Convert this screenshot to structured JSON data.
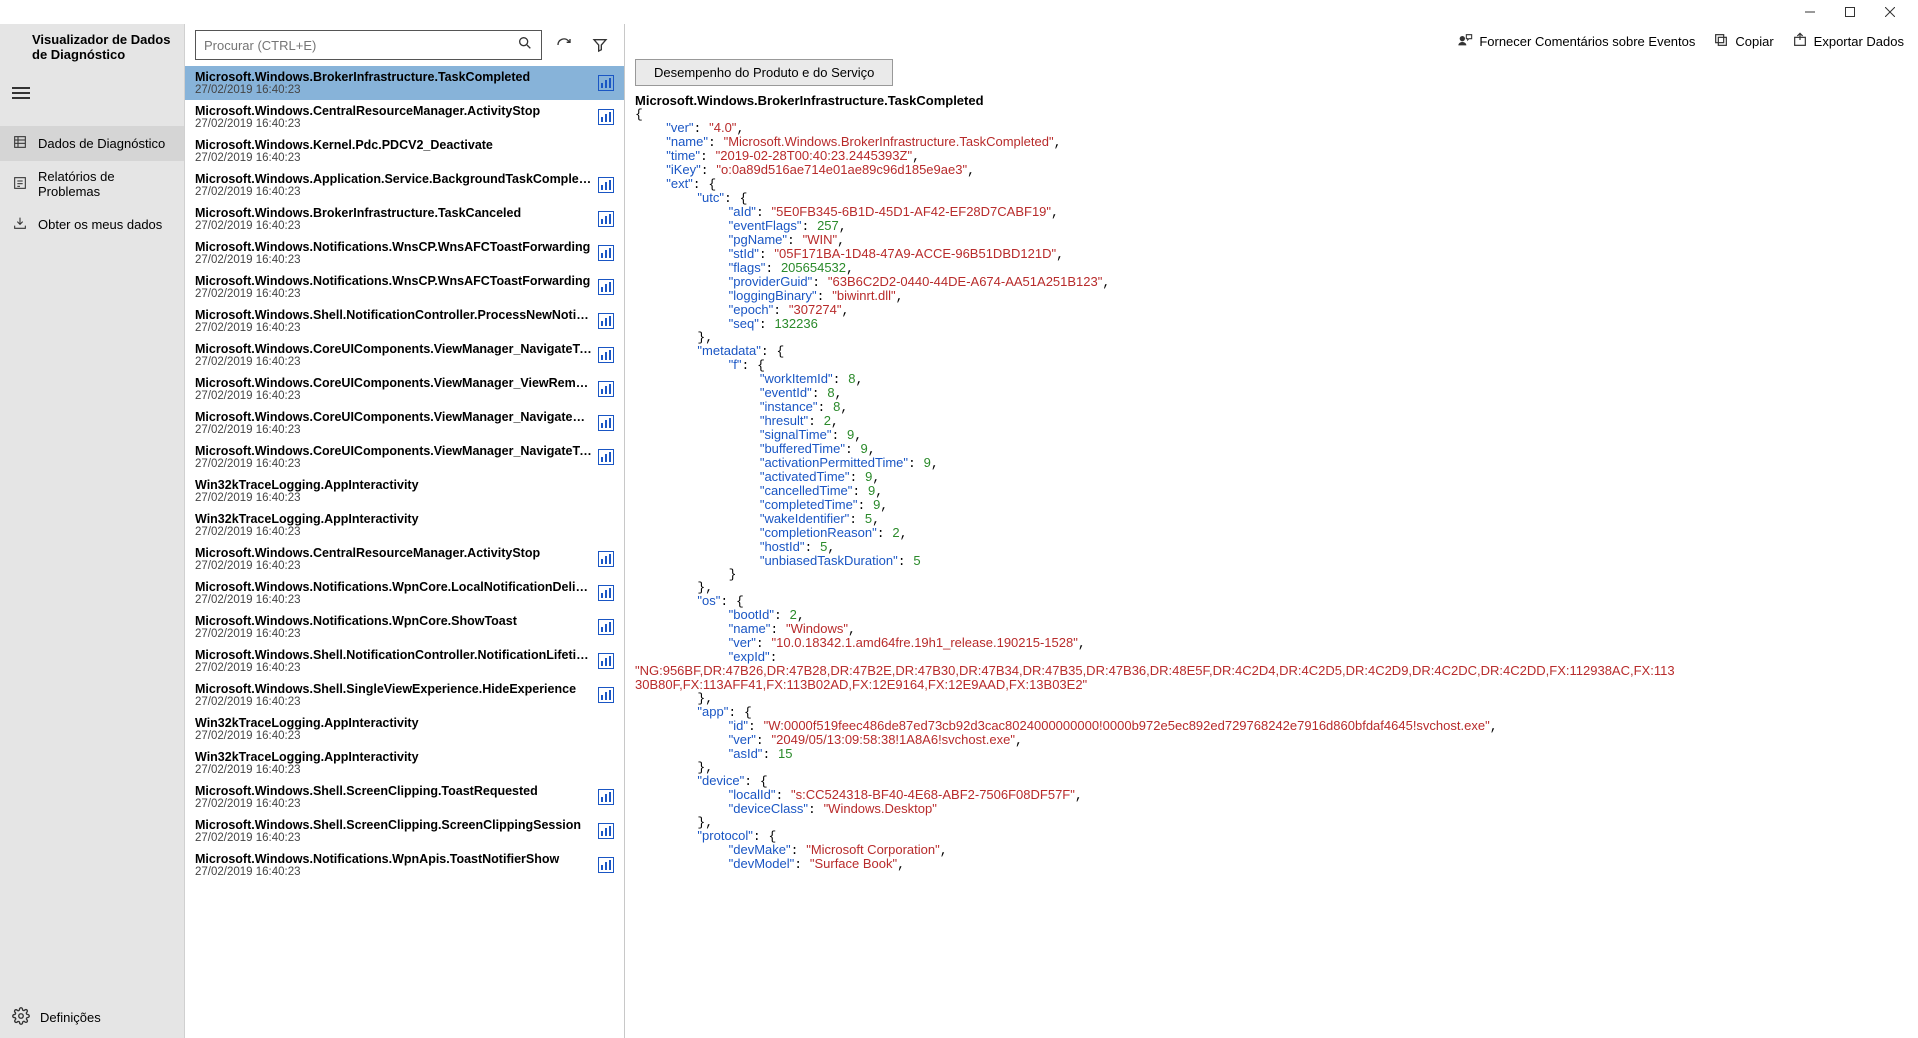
{
  "window": {
    "title": "Visualizador de Dados de Diagnóstico"
  },
  "sidebar": {
    "nav": [
      {
        "label": "Dados de Diagnóstico",
        "active": true
      },
      {
        "label": "Relatórios de Problemas",
        "active": false
      },
      {
        "label": "Obter os meus dados",
        "active": false
      }
    ],
    "settings_label": "Definições"
  },
  "search": {
    "placeholder": "Procurar (CTRL+E)",
    "value": ""
  },
  "toolbar_detail": {
    "feedback": "Fornecer Comentários sobre Eventos",
    "copy": "Copiar",
    "export": "Exportar Dados"
  },
  "category_button": "Desempenho do Produto e do Serviço",
  "events": [
    {
      "name": "Microsoft.Windows.BrokerInfrastructure.TaskCompleted",
      "date": "27/02/2019 16:40:23",
      "hasChart": true,
      "selected": true
    },
    {
      "name": "Microsoft.Windows.CentralResourceManager.ActivityStop",
      "date": "27/02/2019 16:40:23",
      "hasChart": true
    },
    {
      "name": "Microsoft.Windows.Kernel.Pdc.PDCV2_Deactivate",
      "date": "27/02/2019 16:40:23",
      "hasChart": false
    },
    {
      "name": "Microsoft.Windows.Application.Service.BackgroundTaskCompleted",
      "date": "27/02/2019 16:40:23",
      "hasChart": true
    },
    {
      "name": "Microsoft.Windows.BrokerInfrastructure.TaskCanceled",
      "date": "27/02/2019 16:40:23",
      "hasChart": true
    },
    {
      "name": "Microsoft.Windows.Notifications.WnsCP.WnsAFCToastForwarding",
      "date": "27/02/2019 16:40:23",
      "hasChart": true
    },
    {
      "name": "Microsoft.Windows.Notifications.WnsCP.WnsAFCToastForwarding",
      "date": "27/02/2019 16:40:23",
      "hasChart": true
    },
    {
      "name": "Microsoft.Windows.Shell.NotificationController.ProcessNewNotificationActivity",
      "date": "27/02/2019 16:40:23",
      "hasChart": true
    },
    {
      "name": "Microsoft.Windows.CoreUIComponents.ViewManager_NavigateToView",
      "date": "27/02/2019 16:40:23",
      "hasChart": true
    },
    {
      "name": "Microsoft.Windows.CoreUIComponents.ViewManager_ViewRemoved",
      "date": "27/02/2019 16:40:23",
      "hasChart": true
    },
    {
      "name": "Microsoft.Windows.CoreUIComponents.ViewManager_NavigateAwayFromView",
      "date": "27/02/2019 16:40:23",
      "hasChart": true
    },
    {
      "name": "Microsoft.Windows.CoreUIComponents.ViewManager_NavigateToView",
      "date": "27/02/2019 16:40:23",
      "hasChart": true
    },
    {
      "name": "Win32kTraceLogging.AppInteractivity",
      "date": "27/02/2019 16:40:23",
      "hasChart": false
    },
    {
      "name": "Win32kTraceLogging.AppInteractivity",
      "date": "27/02/2019 16:40:23",
      "hasChart": false
    },
    {
      "name": "Microsoft.Windows.CentralResourceManager.ActivityStop",
      "date": "27/02/2019 16:40:23",
      "hasChart": true
    },
    {
      "name": "Microsoft.Windows.Notifications.WpnCore.LocalNotificationDelivered",
      "date": "27/02/2019 16:40:23",
      "hasChart": true
    },
    {
      "name": "Microsoft.Windows.Notifications.WpnCore.ShowToast",
      "date": "27/02/2019 16:40:23",
      "hasChart": true
    },
    {
      "name": "Microsoft.Windows.Shell.NotificationController.NotificationLifetimeActivity",
      "date": "27/02/2019 16:40:23",
      "hasChart": true
    },
    {
      "name": "Microsoft.Windows.Shell.SingleViewExperience.HideExperience",
      "date": "27/02/2019 16:40:23",
      "hasChart": true
    },
    {
      "name": "Win32kTraceLogging.AppInteractivity",
      "date": "27/02/2019 16:40:23",
      "hasChart": false
    },
    {
      "name": "Win32kTraceLogging.AppInteractivity",
      "date": "27/02/2019 16:40:23",
      "hasChart": false
    },
    {
      "name": "Microsoft.Windows.Shell.ScreenClipping.ToastRequested",
      "date": "27/02/2019 16:40:23",
      "hasChart": true
    },
    {
      "name": "Microsoft.Windows.Shell.ScreenClipping.ScreenClippingSession",
      "date": "27/02/2019 16:40:23",
      "hasChart": true
    },
    {
      "name": "Microsoft.Windows.Notifications.WpnApis.ToastNotifierShow",
      "date": "27/02/2019 16:40:23",
      "hasChart": true
    }
  ],
  "detail_json": {
    "title": "Microsoft.Windows.BrokerInfrastructure.TaskCompleted",
    "lines": [
      {
        "indent": 0,
        "prefix": "{",
        "key": null,
        "val": null
      },
      {
        "indent": 1,
        "key": "ver",
        "val": "4.0",
        "type": "str",
        "comma": true
      },
      {
        "indent": 1,
        "key": "name",
        "val": "Microsoft.Windows.BrokerInfrastructure.TaskCompleted",
        "type": "str",
        "comma": true
      },
      {
        "indent": 1,
        "key": "time",
        "val": "2019-02-28T00:40:23.2445393Z",
        "type": "str",
        "comma": true
      },
      {
        "indent": 1,
        "key": "iKey",
        "val": "o:0a89d516ae714e01ae89c96d185e9ae3",
        "type": "str",
        "comma": true
      },
      {
        "indent": 1,
        "key": "ext",
        "suffix": ": {"
      },
      {
        "indent": 2,
        "key": "utc",
        "suffix": ": {"
      },
      {
        "indent": 3,
        "key": "aId",
        "val": "5E0FB345-6B1D-45D1-AF42-EF28D7CABF19",
        "type": "str",
        "comma": true
      },
      {
        "indent": 3,
        "key": "eventFlags",
        "val": "257",
        "type": "num",
        "comma": true
      },
      {
        "indent": 3,
        "key": "pgName",
        "val": "WIN",
        "type": "str",
        "comma": true
      },
      {
        "indent": 3,
        "key": "stId",
        "val": "05F171BA-1D48-47A9-ACCE-96B51DBD121D",
        "type": "str",
        "comma": true
      },
      {
        "indent": 3,
        "key": "flags",
        "val": "205654532",
        "type": "num",
        "comma": true
      },
      {
        "indent": 3,
        "key": "providerGuid",
        "val": "63B6C2D2-0440-44DE-A674-AA51A251B123",
        "type": "str",
        "comma": true
      },
      {
        "indent": 3,
        "key": "loggingBinary",
        "val": "biwinrt.dll",
        "type": "str",
        "comma": true
      },
      {
        "indent": 3,
        "key": "epoch",
        "val": "307274",
        "type": "str",
        "comma": true
      },
      {
        "indent": 3,
        "key": "seq",
        "val": "132236",
        "type": "num"
      },
      {
        "indent": 2,
        "prefix": "},"
      },
      {
        "indent": 2,
        "key": "metadata",
        "suffix": ": {"
      },
      {
        "indent": 3,
        "key": "f",
        "suffix": ": {"
      },
      {
        "indent": 4,
        "key": "workItemId",
        "val": "8",
        "type": "num",
        "comma": true
      },
      {
        "indent": 4,
        "key": "eventId",
        "val": "8",
        "type": "num",
        "comma": true
      },
      {
        "indent": 4,
        "key": "instance",
        "val": "8",
        "type": "num",
        "comma": true
      },
      {
        "indent": 4,
        "key": "hresult",
        "val": "2",
        "type": "num",
        "comma": true
      },
      {
        "indent": 4,
        "key": "signalTime",
        "val": "9",
        "type": "num",
        "comma": true
      },
      {
        "indent": 4,
        "key": "bufferedTime",
        "val": "9",
        "type": "num",
        "comma": true
      },
      {
        "indent": 4,
        "key": "activationPermittedTime",
        "val": "9",
        "type": "num",
        "comma": true
      },
      {
        "indent": 4,
        "key": "activatedTime",
        "val": "9",
        "type": "num",
        "comma": true
      },
      {
        "indent": 4,
        "key": "cancelledTime",
        "val": "9",
        "type": "num",
        "comma": true
      },
      {
        "indent": 4,
        "key": "completedTime",
        "val": "9",
        "type": "num",
        "comma": true
      },
      {
        "indent": 4,
        "key": "wakeIdentifier",
        "val": "5",
        "type": "num",
        "comma": true
      },
      {
        "indent": 4,
        "key": "completionReason",
        "val": "2",
        "type": "num",
        "comma": true
      },
      {
        "indent": 4,
        "key": "hostId",
        "val": "5",
        "type": "num",
        "comma": true
      },
      {
        "indent": 4,
        "key": "unbiasedTaskDuration",
        "val": "5",
        "type": "num"
      },
      {
        "indent": 3,
        "prefix": "}"
      },
      {
        "indent": 2,
        "prefix": "},"
      },
      {
        "indent": 2,
        "key": "os",
        "suffix": ": {"
      },
      {
        "indent": 3,
        "key": "bootId",
        "val": "2",
        "type": "num",
        "comma": true
      },
      {
        "indent": 3,
        "key": "name",
        "val": "Windows",
        "type": "str",
        "comma": true
      },
      {
        "indent": 3,
        "key": "ver",
        "val": "10.0.18342.1.amd64fre.19h1_release.190215-1528",
        "type": "str",
        "comma": true
      },
      {
        "indent": 3,
        "key": "expId",
        "suffix": ":"
      },
      {
        "indent": 0,
        "raw": "\"NG:956BF,DR:47B26,DR:47B28,DR:47B2E,DR:47B30,DR:47B34,DR:47B35,DR:47B36,DR:48E5F,DR:4C2D4,DR:4C2D5,DR:4C2D9,DR:4C2DC,DR:4C2DD,FX:112938AC,FX:113",
        "type": "strraw"
      },
      {
        "indent": 0,
        "raw": "30B80F,FX:113AFF41,FX:113B02AD,FX:12E9164,FX:12E9AAD,FX:13B03E2\"",
        "type": "strraw"
      },
      {
        "indent": 2,
        "prefix": "},"
      },
      {
        "indent": 2,
        "key": "app",
        "suffix": ": {"
      },
      {
        "indent": 3,
        "key": "id",
        "val": "W:0000f519feec486de87ed73cb92d3cac8024000000000!0000b972e5ec892ed729768242e7916d860bfdaf4645!svchost.exe",
        "type": "str",
        "comma": true
      },
      {
        "indent": 3,
        "key": "ver",
        "val": "2049/05/13:09:58:38!1A8A6!svchost.exe",
        "type": "str",
        "comma": true
      },
      {
        "indent": 3,
        "key": "asId",
        "val": "15",
        "type": "num"
      },
      {
        "indent": 2,
        "prefix": "},"
      },
      {
        "indent": 2,
        "key": "device",
        "suffix": ": {"
      },
      {
        "indent": 3,
        "key": "localId",
        "val": "s:CC524318-BF40-4E68-ABF2-7506F08DF57F",
        "type": "str",
        "comma": true
      },
      {
        "indent": 3,
        "key": "deviceClass",
        "val": "Windows.Desktop",
        "type": "str"
      },
      {
        "indent": 2,
        "prefix": "},"
      },
      {
        "indent": 2,
        "key": "protocol",
        "suffix": ": {"
      },
      {
        "indent": 3,
        "key": "devMake",
        "val": "Microsoft Corporation",
        "type": "str",
        "comma": true
      },
      {
        "indent": 3,
        "key": "devModel",
        "val": "Surface Book",
        "type": "str",
        "comma": true
      }
    ]
  }
}
